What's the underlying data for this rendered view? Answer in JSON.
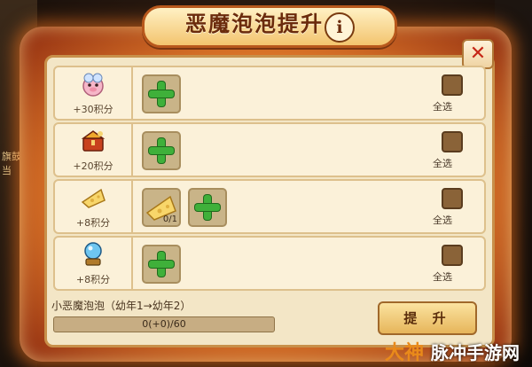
{
  "background": {
    "side_text": "旗鼓相当"
  },
  "dialog": {
    "title": "恶魔泡泡提升",
    "info_icon": "i",
    "close_icon": "✕",
    "rows": [
      {
        "item": "pink-pig-icon",
        "points": "+30积分",
        "select_all": "全选"
      },
      {
        "item": "treasure-chest-icon",
        "points": "+20积分",
        "select_all": "全选"
      },
      {
        "item": "cheese-icon",
        "points": "+8积分",
        "select_all": "全选",
        "count": "0/1"
      },
      {
        "item": "crystal-ball-icon",
        "points": "+8积分",
        "select_all": "全选"
      }
    ],
    "pet_name": "小恶魔泡泡（幼年1→幼年2）",
    "progress": {
      "text": "0(+0)/60",
      "value": 0,
      "max": 60
    },
    "upgrade_button": "提 升"
  },
  "watermark": {
    "logo": "大神",
    "text": "脉冲手游网"
  },
  "colors": {
    "accent": "#e07a2a",
    "plus_green": "#3fb03a",
    "close_red": "#c52516"
  }
}
